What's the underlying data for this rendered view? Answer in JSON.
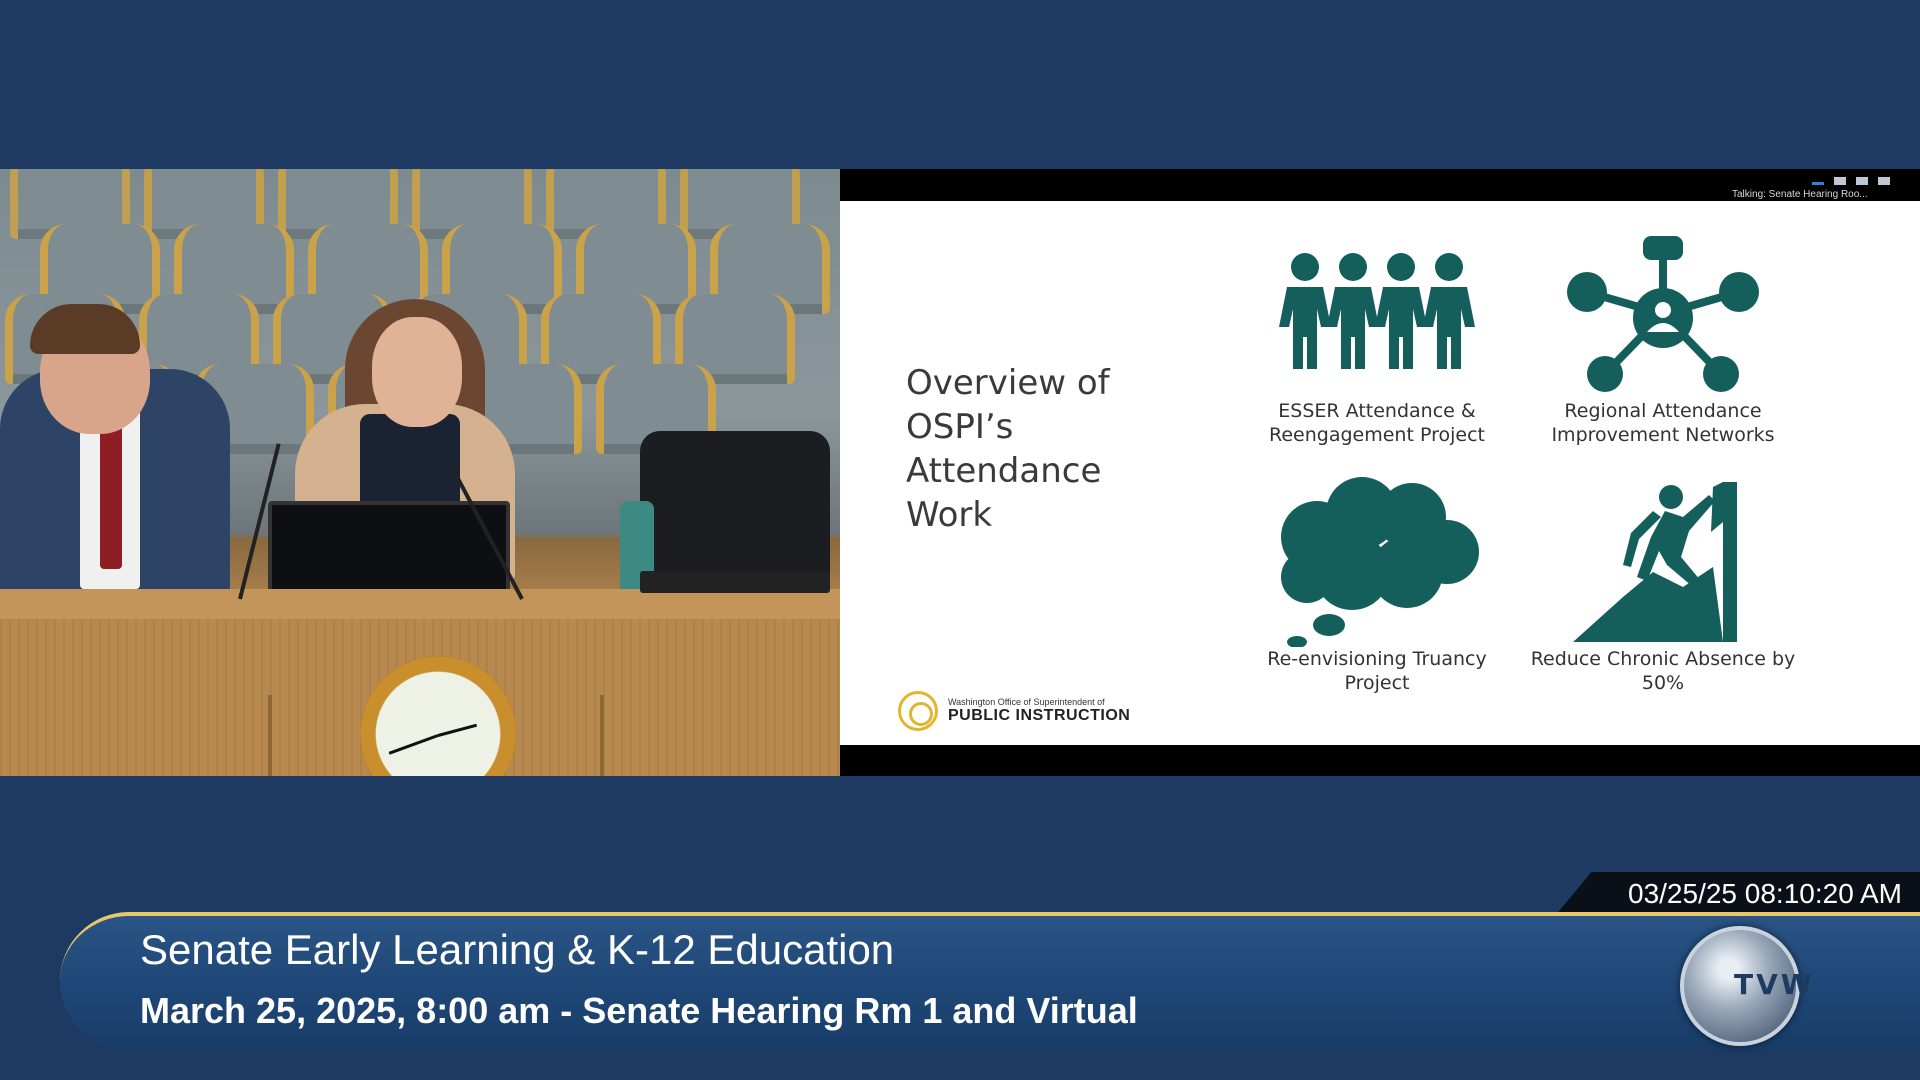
{
  "slide": {
    "title": "Overview of OSPI’s Attendance Work",
    "logo_small": "Washington Office of Superintendent of",
    "logo_big": "PUBLIC INSTRUCTION",
    "items": [
      {
        "caption": "ESSER Attendance & Reengagement Project",
        "icon": "people-group-icon"
      },
      {
        "caption": "Regional Attendance Improvement Networks",
        "icon": "network-hub-icon"
      },
      {
        "caption": "Re-envisioning Truancy Project",
        "icon": "thought-cloud-icon"
      },
      {
        "caption": "Reduce Chronic Absence by 50%",
        "icon": "mountain-climber-icon"
      }
    ],
    "accent_color": "#145f5c"
  },
  "viewer": {
    "talking": "Talking: Senate Hearing Roo..."
  },
  "timestamp": "03/25/25 08:10:20 AM",
  "lower_third": {
    "title": "Senate Early Learning & K-12 Education",
    "subtitle": "March 25, 2025, 8:00 am - Senate Hearing Rm 1 and Virtual",
    "logo_text": "TVW"
  }
}
